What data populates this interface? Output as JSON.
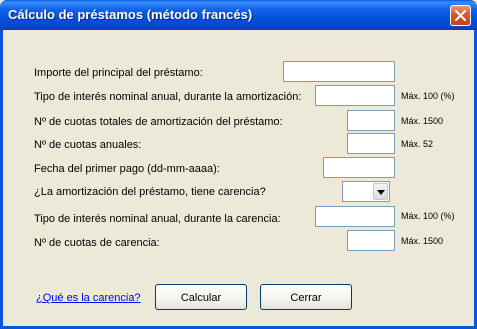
{
  "window": {
    "title": "Cálculo de préstamos (método francés)"
  },
  "form": {
    "principal_label": "Importe del principal del préstamo:",
    "rate_label": "Tipo de interés nominal anual, durante la amortización:",
    "rate_hint": "Máx. 100 (%)",
    "total_installments_label": "Nº de cuotas totales de amortización del préstamo:",
    "total_installments_hint": "Máx. 1500",
    "annual_installments_label": "Nº de cuotas anuales:",
    "annual_installments_hint": "Máx. 52",
    "first_payment_label": "Fecha del primer pago (dd-mm-aaaa):",
    "grace_question_label": "¿La amortización del préstamo, tiene carencia?",
    "grace_rate_label": "Tipo de interés nominal anual, durante la carencia:",
    "grace_rate_hint": "Máx. 100 (%)",
    "grace_installments_label": "Nº de cuotas de carencia:",
    "grace_installments_hint": "Máx. 1500",
    "principal_value": "",
    "rate_value": "",
    "total_installments_value": "",
    "annual_installments_value": "",
    "first_payment_value": "",
    "grace_selected": "",
    "grace_rate_value": "",
    "grace_installments_value": ""
  },
  "footer": {
    "help_link": "¿Qué es la carencia?",
    "calculate_label": "Calcular",
    "close_label": "Cerrar"
  },
  "icons": {
    "close": "close-icon",
    "dropdown": "chevron-down-icon"
  },
  "colors": {
    "titlebar": "#0550dc",
    "close_button": "#d4592e",
    "dialog_background": "#ece9d8",
    "link": "#0000ff"
  }
}
